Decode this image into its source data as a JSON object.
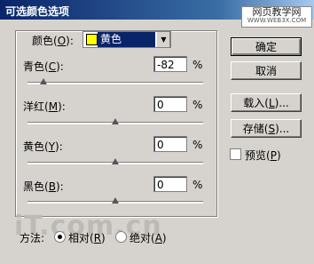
{
  "title": "可选颜色选项",
  "watermark": {
    "line1": "网页教学网",
    "line2": "WWW.WEB3X.COM"
  },
  "colors": {
    "label": "颜色",
    "key": "O",
    "selected": "黄色"
  },
  "sliders": [
    {
      "name": "青色",
      "key": "C",
      "value": "-82",
      "percent": -82
    },
    {
      "name": "洋红",
      "key": "M",
      "value": "0",
      "percent": 0
    },
    {
      "name": "黄色",
      "key": "Y",
      "value": "0",
      "percent": 0
    },
    {
      "name": "黑色",
      "key": "B",
      "value": "0",
      "percent": 0
    }
  ],
  "unit": "%",
  "buttons": {
    "ok": "确定",
    "cancel": "取消",
    "load_text": "载入(",
    "load_key": "L",
    "load_end": ")...",
    "save_text": "存储(",
    "save_key": "S",
    "save_end": ")..."
  },
  "preview": {
    "label": "预览",
    "key": "P",
    "checked": false
  },
  "method": {
    "label": "方法:",
    "relative": {
      "label": "相对",
      "key": "R",
      "selected": true
    },
    "absolute": {
      "label": "绝对",
      "key": "A",
      "selected": false
    }
  },
  "logo_text": "iT.com.cn"
}
